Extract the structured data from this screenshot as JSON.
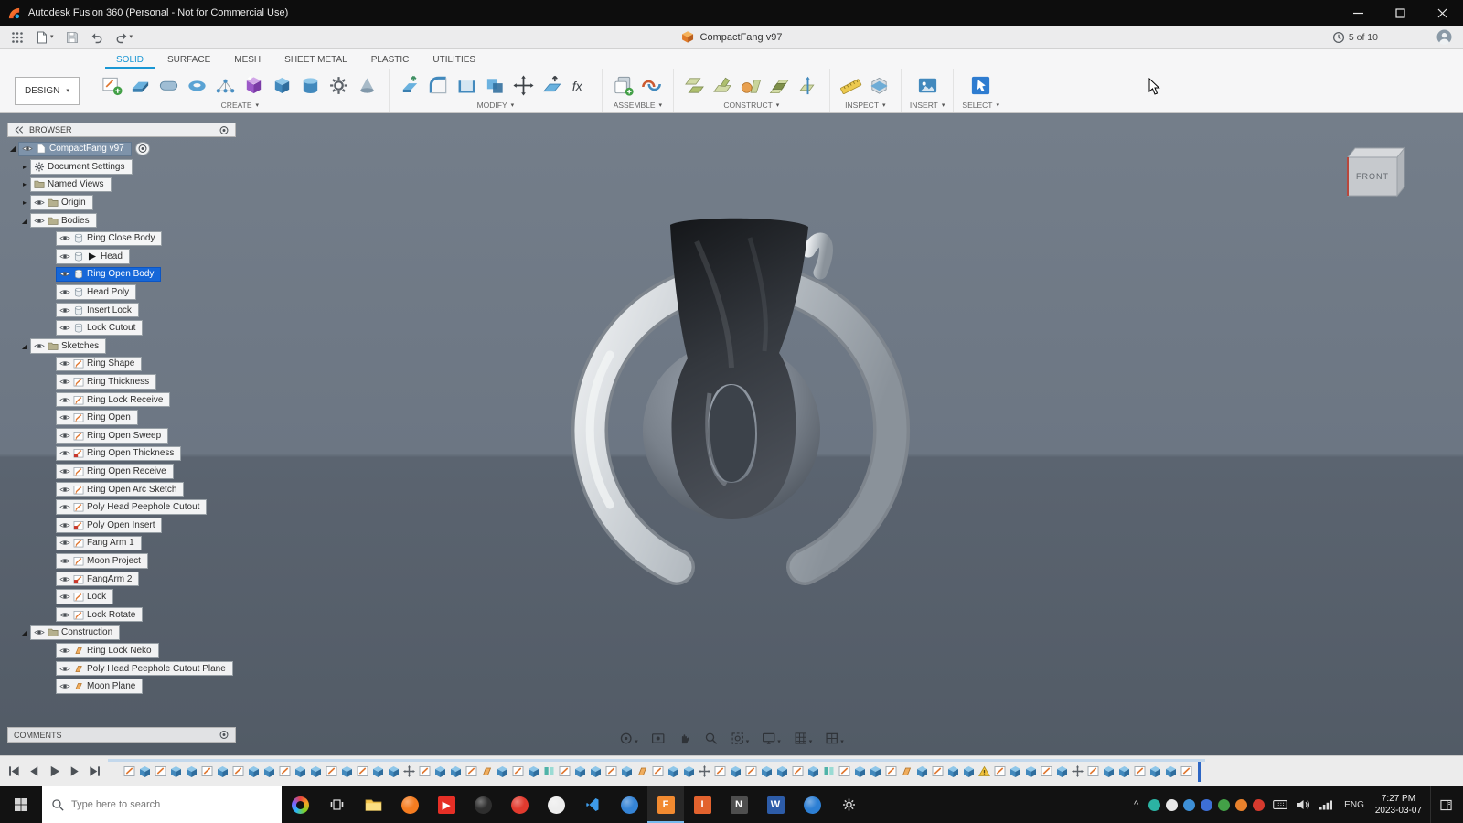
{
  "titlebar": {
    "title": "Autodesk Fusion 360 (Personal - Not for Commercial Use)"
  },
  "docbar": {
    "tab_title": "CompactFang v97",
    "job_status": "5 of 10"
  },
  "ribbon": {
    "workspace": "DESIGN",
    "tabs": [
      {
        "label": "SOLID",
        "active": true
      },
      {
        "label": "SURFACE",
        "active": false
      },
      {
        "label": "MESH",
        "active": false
      },
      {
        "label": "SHEET METAL",
        "active": false
      },
      {
        "label": "PLASTIC",
        "active": false
      },
      {
        "label": "UTILITIES",
        "active": false
      }
    ],
    "groups": [
      {
        "label": "CREATE",
        "icons": [
          "create-sketch",
          "extrude",
          "revolve",
          "sweep",
          "pattern",
          "create-form",
          "box",
          "cylinder",
          "coil",
          "primitive"
        ]
      },
      {
        "label": "MODIFY",
        "icons": [
          "press-pull",
          "fillet",
          "shell",
          "combine",
          "move-copy",
          "offset-face",
          "change-parameters"
        ]
      },
      {
        "label": "ASSEMBLE",
        "icons": [
          "new-component",
          "joint"
        ]
      },
      {
        "label": "CONSTRUCT",
        "icons": [
          "offset-plane",
          "plane-at-angle",
          "tangent-plane",
          "midplane",
          "axis"
        ]
      },
      {
        "label": "INSPECT",
        "icons": [
          "measure",
          "section-analysis"
        ]
      },
      {
        "label": "INSERT",
        "icons": [
          "insert-image"
        ]
      },
      {
        "label": "SELECT",
        "icons": [
          "select"
        ]
      }
    ]
  },
  "browser": {
    "header": "BROWSER",
    "root_label": "CompactFang v97",
    "items": [
      {
        "label": "Document Settings",
        "level": 1,
        "exp": "closed",
        "icons": [
          "gear"
        ]
      },
      {
        "label": "Named Views",
        "level": 1,
        "exp": "closed",
        "icons": [
          "folder"
        ]
      },
      {
        "label": "Origin",
        "level": 1,
        "exp": "closed",
        "icons": [
          "eye",
          "folder"
        ]
      },
      {
        "label": "Bodies",
        "level": 1,
        "exp": "open",
        "icons": [
          "eye",
          "folder"
        ]
      },
      {
        "label": "Ring Close Body",
        "level": 2,
        "icons": [
          "eye",
          "body"
        ]
      },
      {
        "label": "Head",
        "level": 2,
        "icons": [
          "eye",
          "body",
          "arrow"
        ]
      },
      {
        "label": "Ring Open Body",
        "level": 2,
        "selected": true,
        "icons": [
          "eye",
          "body"
        ]
      },
      {
        "label": "Head Poly",
        "level": 2,
        "icons": [
          "eye",
          "body"
        ]
      },
      {
        "label": "Insert Lock",
        "level": 2,
        "icons": [
          "eye",
          "body"
        ]
      },
      {
        "label": "Lock Cutout",
        "level": 2,
        "icons": [
          "eye",
          "body"
        ]
      },
      {
        "label": "Sketches",
        "level": 1,
        "exp": "open",
        "icons": [
          "eye",
          "folder"
        ]
      },
      {
        "label": "Ring Shape",
        "level": 2,
        "icons": [
          "eye",
          "sketch"
        ]
      },
      {
        "label": "Ring Thickness",
        "level": 2,
        "icons": [
          "eye",
          "sketch"
        ]
      },
      {
        "label": "Ring Lock Receive",
        "level": 2,
        "icons": [
          "eye",
          "sketch"
        ]
      },
      {
        "label": "Ring Open",
        "level": 2,
        "icons": [
          "eye",
          "sketch"
        ]
      },
      {
        "label": "Ring Open Sweep",
        "level": 2,
        "icons": [
          "eye",
          "sketch"
        ]
      },
      {
        "label": "Ring Open Thickness",
        "level": 2,
        "icons": [
          "eye",
          "sketch-red"
        ]
      },
      {
        "label": "Ring Open Receive",
        "level": 2,
        "icons": [
          "eye",
          "sketch"
        ]
      },
      {
        "label": "Ring Open Arc Sketch",
        "level": 2,
        "icons": [
          "eye",
          "sketch"
        ]
      },
      {
        "label": "Poly Head Peephole Cutout",
        "level": 2,
        "icons": [
          "eye",
          "sketch"
        ]
      },
      {
        "label": "Poly Open Insert",
        "level": 2,
        "icons": [
          "eye",
          "sketch-red"
        ]
      },
      {
        "label": "Fang Arm 1",
        "level": 2,
        "icons": [
          "eye",
          "sketch"
        ]
      },
      {
        "label": "Moon Project",
        "level": 2,
        "icons": [
          "eye",
          "sketch"
        ]
      },
      {
        "label": "FangArm 2",
        "level": 2,
        "icons": [
          "eye",
          "sketch-red"
        ]
      },
      {
        "label": "Lock",
        "level": 2,
        "icons": [
          "eye",
          "sketch"
        ]
      },
      {
        "label": "Lock Rotate",
        "level": 2,
        "icons": [
          "eye",
          "sketch"
        ]
      },
      {
        "label": "Construction",
        "level": 1,
        "exp": "open",
        "icons": [
          "eye",
          "folder"
        ]
      },
      {
        "label": "Ring Lock Neko",
        "level": 2,
        "icons": [
          "eye",
          "plane"
        ]
      },
      {
        "label": "Poly Head Peephole Cutout Plane",
        "level": 2,
        "icons": [
          "eye",
          "plane"
        ]
      },
      {
        "label": "Moon Plane",
        "level": 2,
        "icons": [
          "eye",
          "plane"
        ]
      }
    ]
  },
  "viewcube": {
    "front_label": "FRONT"
  },
  "comments": {
    "label": "COMMENTS"
  },
  "navbar": {
    "icons": [
      {
        "name": "orbit-icon",
        "type": "orbit",
        "caret": true
      },
      {
        "name": "look-at-icon",
        "type": "lookat",
        "caret": false
      },
      {
        "name": "pan-icon",
        "type": "pan",
        "caret": false
      },
      {
        "name": "zoom-icon",
        "type": "zoom",
        "caret": false
      },
      {
        "name": "fit-icon",
        "type": "fit",
        "caret": true
      },
      {
        "name": "display-settings-icon",
        "type": "display",
        "caret": true
      },
      {
        "name": "grid-settings-icon",
        "type": "grid",
        "caret": true
      },
      {
        "name": "viewports-icon",
        "type": "viewports",
        "caret": true
      }
    ]
  },
  "timeline": {
    "features": [
      "sk",
      "ex",
      "sk",
      "ex",
      "ex",
      "sk",
      "ex",
      "sk",
      "ex",
      "ex",
      "sk",
      "ex",
      "ex",
      "sk",
      "ex",
      "sk",
      "ex",
      "ex",
      "mv",
      "sk",
      "ex",
      "ex",
      "sk",
      "pl",
      "ex",
      "sk",
      "ex",
      "mi",
      "sk",
      "ex",
      "ex",
      "sk",
      "ex",
      "pl",
      "sk",
      "ex",
      "ex",
      "mv",
      "sk",
      "ex",
      "sk",
      "ex",
      "ex",
      "sk",
      "ex",
      "mi",
      "sk",
      "ex",
      "ex",
      "sk",
      "pl",
      "ex",
      "sk",
      "ex",
      "ex",
      "wr",
      "sk",
      "ex",
      "ex",
      "sk",
      "ex",
      "mv",
      "sk",
      "ex",
      "ex",
      "sk",
      "ex",
      "ex",
      "sk"
    ]
  },
  "taskbar": {
    "search_placeholder": "Type here to search",
    "apps": [
      {
        "name": "cortana-app-icon",
        "shape": "swirl"
      },
      {
        "name": "task-view-icon",
        "shape": "taskview"
      },
      {
        "name": "file-explorer-icon",
        "shape": "folder"
      },
      {
        "name": "firefox-icon",
        "shape": "circle",
        "color": "#f57c20"
      },
      {
        "name": "youtube-icon",
        "shape": "tile",
        "color": "#e62f26",
        "glyph": "▶"
      },
      {
        "name": "app-icon-1",
        "shape": "circle",
        "color": "#2e2e2e"
      },
      {
        "name": "opera-icon",
        "shape": "circle",
        "color": "#e23a2e"
      },
      {
        "name": "app-icon-2",
        "shape": "circle",
        "color": "#ededed"
      },
      {
        "name": "vscode-icon",
        "shape": "vscode"
      },
      {
        "name": "edge-icon",
        "shape": "circle",
        "color": "#3584d6"
      },
      {
        "name": "fusion-360-icon",
        "shape": "tile",
        "color": "#f28a30",
        "glyph": "F",
        "active": true
      },
      {
        "name": "app-icon-3",
        "shape": "tile",
        "color": "#e2622e",
        "glyph": "I"
      },
      {
        "name": "app-icon-4",
        "shape": "tile",
        "color": "#4e4e4e",
        "glyph": "N"
      },
      {
        "name": "app-icon-5",
        "shape": "tile",
        "color": "#2d5ca8",
        "glyph": "W"
      },
      {
        "name": "app-icon-6",
        "shape": "circle",
        "color": "#2d7fd4"
      },
      {
        "name": "settings-icon",
        "shape": "gear"
      }
    ],
    "tray_icons": [
      {
        "name": "antivirus-tray-icon",
        "color": "#2bb3a3"
      },
      {
        "name": "onedrive-tray-icon",
        "color": "#e6e6e6"
      },
      {
        "name": "blue-app-tray-icon",
        "color": "#3d8fd6"
      },
      {
        "name": "bluetooth-tray-icon",
        "color": "#3d6fd6"
      },
      {
        "name": "security-tray-icon",
        "color": "#43a047"
      },
      {
        "name": "orange-app-tray-icon",
        "color": "#e8812c"
      },
      {
        "name": "red-app-tray-icon",
        "color": "#d63a2e"
      }
    ],
    "tray": {
      "language": "ENG",
      "time": "7:27 PM",
      "date": "2023-03-07"
    }
  }
}
